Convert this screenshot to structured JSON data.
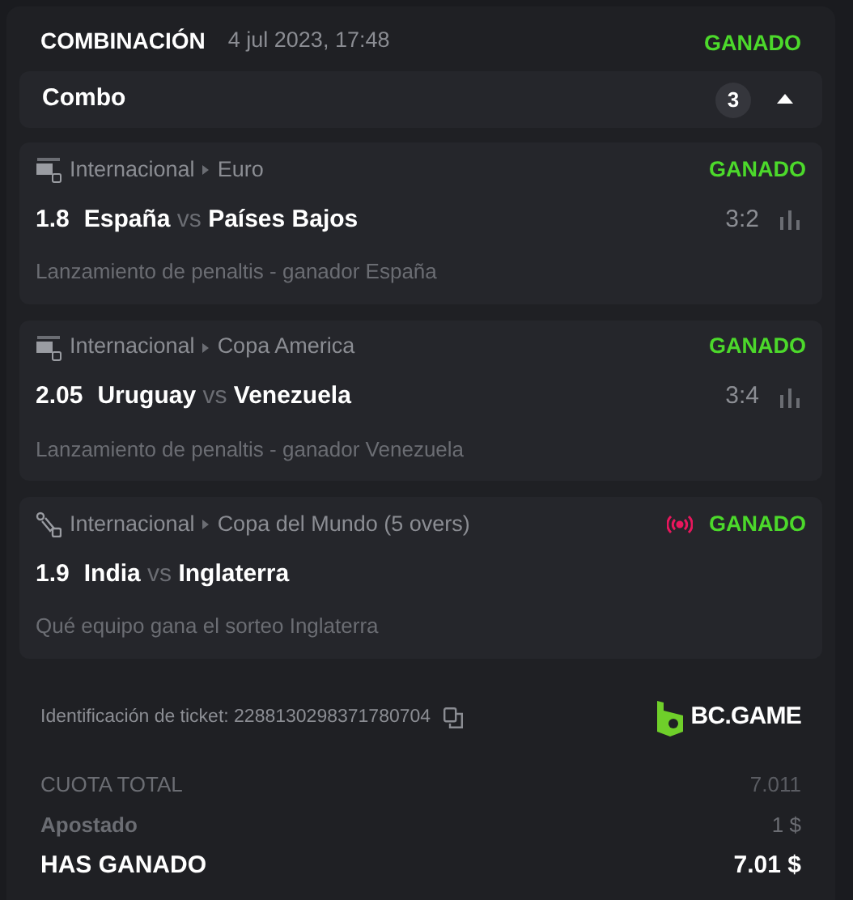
{
  "header": {
    "type": "COMBINACIÓN",
    "date": "4 jul 2023, 17:48",
    "status": "GANADO"
  },
  "combo": {
    "label": "Combo",
    "count": "3",
    "expanded": true
  },
  "bets": [
    {
      "kind": "fifa",
      "category": "Internacional",
      "league": "Euro",
      "live": false,
      "status": "GANADO",
      "odds": "1.8",
      "home": "España",
      "vs": "vs",
      "away": "Países Bajos",
      "score": "3:2",
      "market": "Lanzamiento de penaltis - ganador España"
    },
    {
      "kind": "fifa",
      "category": "Internacional",
      "league": "Copa America",
      "live": false,
      "status": "GANADO",
      "odds": "2.05",
      "home": "Uruguay",
      "vs": "vs",
      "away": "Venezuela",
      "score": "3:4",
      "market": "Lanzamiento de penaltis - ganador Venezuela"
    },
    {
      "kind": "cricket",
      "category": "Internacional",
      "league": "Copa del Mundo (5 overs)",
      "live": true,
      "status": "GANADO",
      "odds": "1.9",
      "home": "India",
      "vs": "vs",
      "away": "Inglaterra",
      "market": "Qué equipo gana el sorteo Inglaterra"
    }
  ],
  "ticket": {
    "label": "Identificación de ticket: 2288130298371780704",
    "brand": "BC.GAME"
  },
  "totals": [
    {
      "kind": "odds",
      "label": "CUOTA TOTAL",
      "value": "7.011"
    },
    {
      "kind": "stake",
      "label": "Apostado",
      "value": "1 $"
    },
    {
      "kind": "win",
      "label": "HAS GANADO",
      "value": "7.01 $"
    }
  ]
}
